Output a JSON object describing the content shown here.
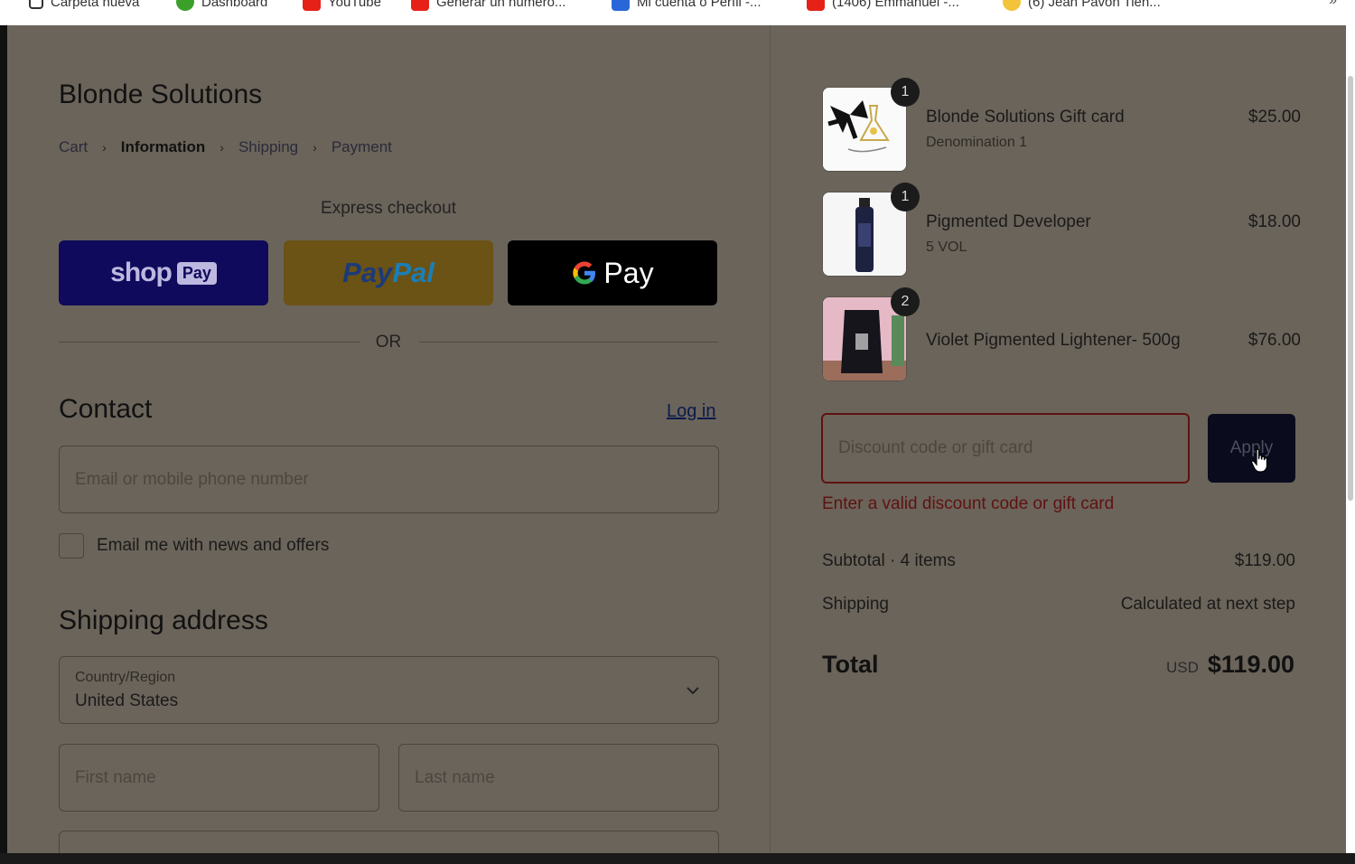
{
  "bookmarks": [
    {
      "label": "Carpeta nueva",
      "icon": "folder-icon",
      "color": "#ffffff"
    },
    {
      "label": "Dashboard",
      "icon": "dashboard-icon",
      "color": "#3aa02a"
    },
    {
      "label": "YouTube",
      "icon": "youtube-icon",
      "color": "#e62117"
    },
    {
      "label": "Generar un número...",
      "icon": "flipkart-icon",
      "color": "#e62117"
    },
    {
      "label": "Mi cuenta o Perfil -...",
      "icon": "bank-icon",
      "color": "#2b66d9"
    },
    {
      "label": "(1406) Emmanuel -...",
      "icon": "youtube-icon",
      "color": "#e62117"
    },
    {
      "label": "(6) Jean Pavon Tien...",
      "icon": "emoji-icon",
      "color": "#f3c43a"
    }
  ],
  "store": {
    "title": "Blonde Solutions"
  },
  "breadcrumb": {
    "cart": "Cart",
    "information": "Information",
    "shipping": "Shipping",
    "payment": "Payment",
    "sep": "›"
  },
  "express": {
    "label": "Express checkout",
    "shop_text": "shop",
    "shop_pay": "Pay",
    "paypal_a": "Pay",
    "paypal_b": "Pal",
    "gpay_g": "G",
    "gpay_text": "Pay"
  },
  "or_text": "OR",
  "contact": {
    "heading": "Contact",
    "login": "Log in",
    "email_placeholder": "Email or mobile phone number",
    "newsletter": "Email me with news and offers"
  },
  "shipping": {
    "heading": "Shipping address",
    "country_label": "Country/Region",
    "country_value": "United States",
    "first_name_placeholder": "First name",
    "last_name_placeholder": "Last name"
  },
  "items": [
    {
      "name": "Blonde Solutions Gift card",
      "variant": "Denomination 1",
      "price": "$25.00",
      "qty": "1"
    },
    {
      "name": "Pigmented Developer",
      "variant": "5 VOL",
      "price": "$18.00",
      "qty": "1"
    },
    {
      "name": "Violet Pigmented Lightener- 500g",
      "variant": "",
      "price": "$76.00",
      "qty": "2"
    }
  ],
  "discount": {
    "placeholder": "Discount code or gift card",
    "apply": "Apply",
    "error": "Enter a valid discount code or gift card"
  },
  "summary": {
    "subtotal_label": "Subtotal · 4 items",
    "subtotal_value": "$119.00",
    "shipping_label": "Shipping",
    "shipping_value": "Calculated at next step",
    "total_label": "Total",
    "currency": "USD",
    "total_value": "$119.00"
  },
  "colors": {
    "overlay": "#6b645a",
    "shop_pay": "#100a5c",
    "error": "#5e1212"
  }
}
